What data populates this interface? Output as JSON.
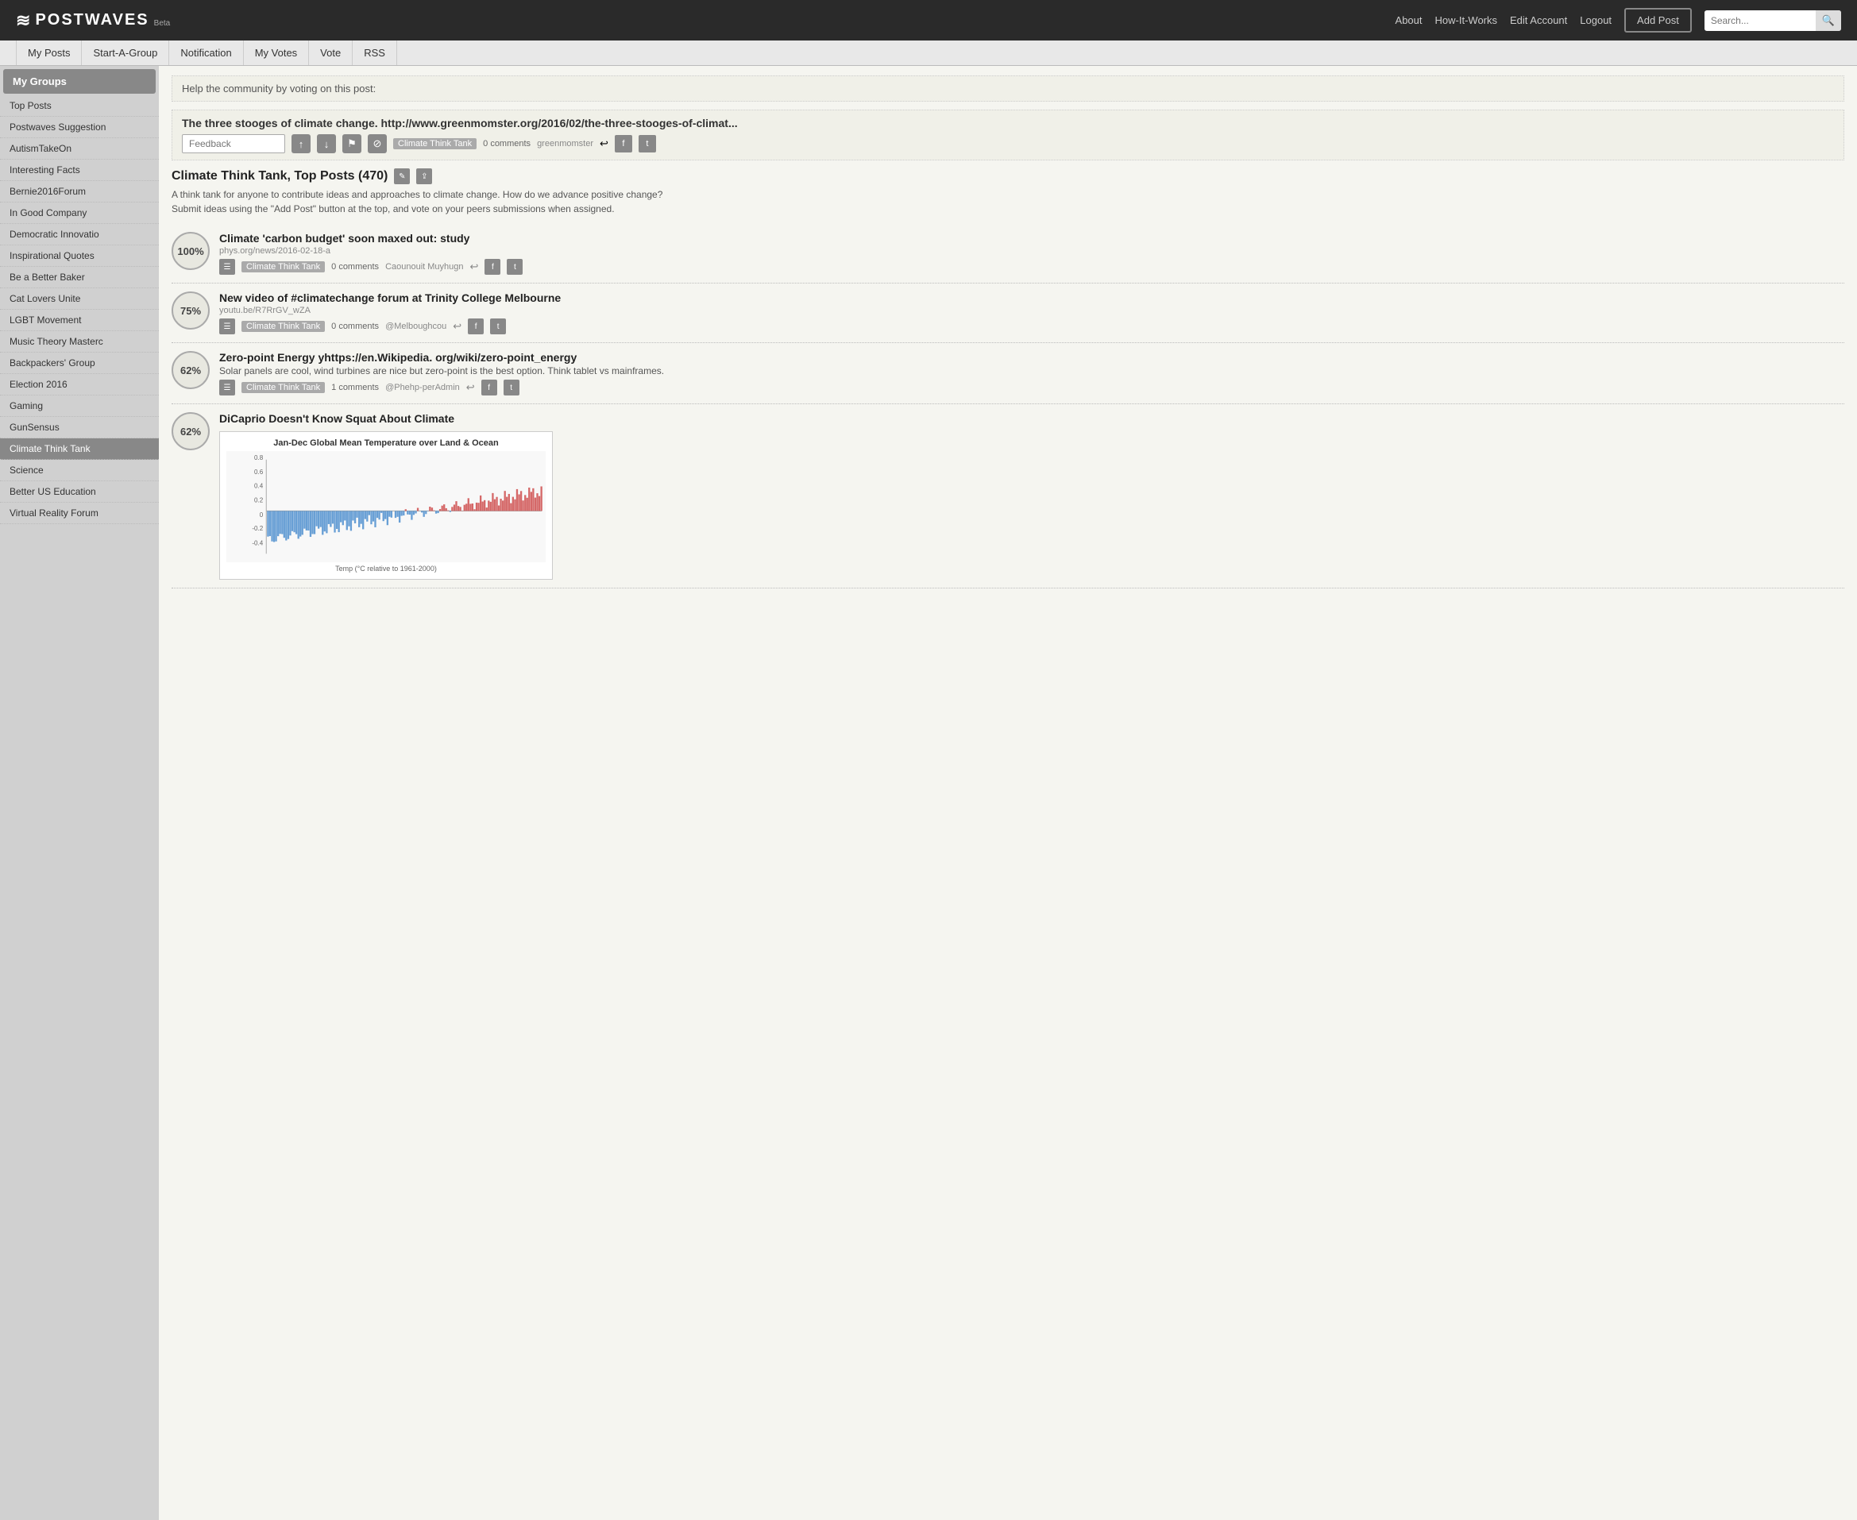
{
  "header": {
    "logo_icon": "≋",
    "logo_text": "POSTWAVES",
    "logo_beta": "Beta",
    "nav": {
      "about": "About",
      "how_it_works": "How-It-Works",
      "edit_account": "Edit Account",
      "logout": "Logout",
      "add_post": "Add Post"
    },
    "search_placeholder": "Search..."
  },
  "sub_nav": {
    "tabs": [
      "My Posts",
      "Start-A-Group",
      "Notification",
      "My Votes",
      "Vote",
      "RSS"
    ]
  },
  "sidebar": {
    "section_label": "My Groups",
    "items": [
      {
        "label": "Top Posts",
        "active": false
      },
      {
        "label": "Postwaves Suggestion",
        "active": false
      },
      {
        "label": "AutismTakeOn",
        "active": false
      },
      {
        "label": "Interesting Facts",
        "active": false
      },
      {
        "label": "Bernie2016Forum",
        "active": false
      },
      {
        "label": "In Good Company",
        "active": false
      },
      {
        "label": "Democratic Innovatio",
        "active": false
      },
      {
        "label": "Inspirational Quotes",
        "active": false
      },
      {
        "label": "Be a Better Baker",
        "active": false
      },
      {
        "label": "Cat Lovers Unite",
        "active": false
      },
      {
        "label": "LGBT Movement",
        "active": false
      },
      {
        "label": "Music Theory Masterc",
        "active": false
      },
      {
        "label": "Backpackers' Group",
        "active": false
      },
      {
        "label": "Election 2016",
        "active": false
      },
      {
        "label": "Gaming",
        "active": false
      },
      {
        "label": "GunSensus",
        "active": false
      },
      {
        "label": "Climate Think Tank",
        "active": true
      },
      {
        "label": "Science",
        "active": false
      },
      {
        "label": "Better US Education",
        "active": false
      },
      {
        "label": "Virtual Reality Forum",
        "active": false
      }
    ]
  },
  "vote_prompt": "Help the community by voting on this post:",
  "vote_post": {
    "title": "The three stooges of climate change. http://www.greenmomster.org/2016/02/the-three-stooges-of-climat...",
    "feedback_placeholder": "Feedback",
    "tag": "Climate Think Tank",
    "comments": "0 comments",
    "author": "greenmomster"
  },
  "group": {
    "title": "Climate Think Tank, Top Posts (470)",
    "description": "A think tank for anyone to contribute ideas and approaches to climate change. How do we advance positive change?",
    "instructions": "Submit ideas using the \"Add Post\" button at the top, and vote on your peers submissions when assigned."
  },
  "posts": [
    {
      "score": "100%",
      "title": "Climate 'carbon budget' soon maxed out: study",
      "url": "phys.org/news/2016-02-18-a",
      "tag": "Climate Think Tank",
      "comments": "0 comments",
      "author": "Caounouit Muyhugn",
      "description": null
    },
    {
      "score": "75%",
      "title": "New video of #climatechange forum at Trinity College Melbourne",
      "url": "youtu.be/R7RrGV_wZA",
      "tag": "Climate Think Tank",
      "comments": "0 comments",
      "author": "@Melboughcou",
      "description": null
    },
    {
      "score": "62%",
      "title": "Zero-point Energy yhttps://en.Wikipedia. org/wiki/zero-point_energy",
      "url": null,
      "tag": "Climate Think Tank",
      "comments": "1 comments",
      "author": "@Phehp-perAdmin",
      "description": "Solar panels are cool, wind turbines are nice but zero-point is the best option. Think tablet vs mainframes."
    },
    {
      "score": "62%",
      "title": "DiCaprio Doesn't Know Squat About Climate",
      "url": null,
      "tag": null,
      "comments": null,
      "author": null,
      "description": null,
      "has_chart": true
    }
  ],
  "chart": {
    "title": "Jan-Dec Global Mean Temperature over Land & Ocean",
    "y_label": "Temp (°C relative to 1961-2000)",
    "note": "Temperature anomaly chart"
  }
}
